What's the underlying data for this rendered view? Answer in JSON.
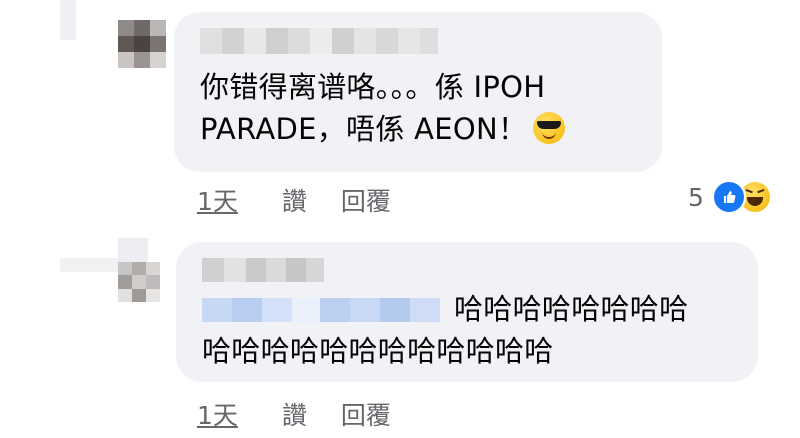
{
  "comments": [
    {
      "text_lines": [
        "你错得离谱咯。。。係 IPOH",
        "PARADE，唔係 AEON！"
      ],
      "emoji": "sunglasses-emoji",
      "time": "1天",
      "like": "讚",
      "reply": "回覆",
      "reaction_count": "5",
      "reactions": [
        "like-icon",
        "haha-icon"
      ]
    },
    {
      "text_lines": [
        "哈哈哈哈哈哈哈哈",
        "哈哈哈哈哈哈哈哈哈哈哈哈"
      ],
      "time": "1天",
      "like": "讚",
      "reply": "回覆"
    }
  ],
  "colors": {
    "bubble": "#f0f2f5",
    "meta": "#65676b",
    "like": "#1877f2",
    "mention_blur": "#c7d8f5"
  }
}
